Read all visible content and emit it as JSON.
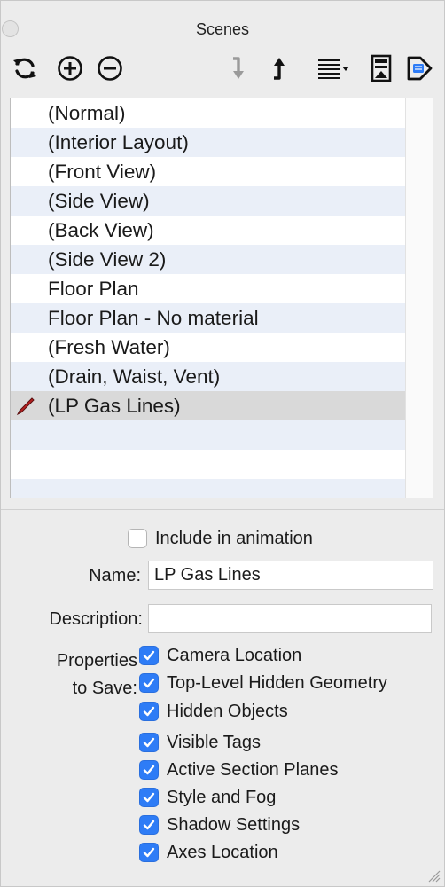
{
  "window": {
    "title": "Scenes"
  },
  "toolbar": {
    "buttons": [
      {
        "icon": "refresh-icon"
      },
      {
        "icon": "add-icon"
      },
      {
        "icon": "remove-icon"
      },
      {
        "icon": "move-down-icon"
      },
      {
        "icon": "move-up-icon"
      },
      {
        "icon": "list-view-icon"
      },
      {
        "icon": "show-details-icon"
      },
      {
        "icon": "next-scene-icon"
      }
    ]
  },
  "scenes": {
    "items": [
      {
        "label": "(Normal)"
      },
      {
        "label": "(Interior Layout)"
      },
      {
        "label": "(Front View)"
      },
      {
        "label": "(Side View)"
      },
      {
        "label": "(Back View)"
      },
      {
        "label": "(Side View 2)"
      },
      {
        "label": "Floor Plan"
      },
      {
        "label": "Floor Plan - No material"
      },
      {
        "label": "(Fresh Water)"
      },
      {
        "label": "(Drain, Waist, Vent)"
      },
      {
        "label": "(LP Gas Lines)",
        "selected": true,
        "icon": "pencil-icon"
      }
    ]
  },
  "form": {
    "include_animation": {
      "label": "Include in animation",
      "checked": false
    },
    "name": {
      "label": "Name:",
      "value": "LP Gas Lines"
    },
    "description": {
      "label": "Description:",
      "value": ""
    },
    "properties_label_line1": "Properties",
    "properties_label_line2": "to Save:",
    "properties": [
      {
        "label": "Camera Location",
        "checked": true
      },
      {
        "label": "Top-Level Hidden Geometry",
        "checked": true
      },
      {
        "label": "Hidden Objects",
        "checked": true
      },
      {
        "label": "Visible Tags",
        "checked": true
      },
      {
        "label": "Active Section Planes",
        "checked": true
      },
      {
        "label": "Style and Fog",
        "checked": true
      },
      {
        "label": "Shadow Settings",
        "checked": true
      },
      {
        "label": "Axes Location",
        "checked": true
      }
    ]
  },
  "colors": {
    "accent": "#2e7cf6",
    "row_alt": "#eaeff8",
    "row_selected": "#d9d9d9",
    "pencil": "#b52020"
  }
}
